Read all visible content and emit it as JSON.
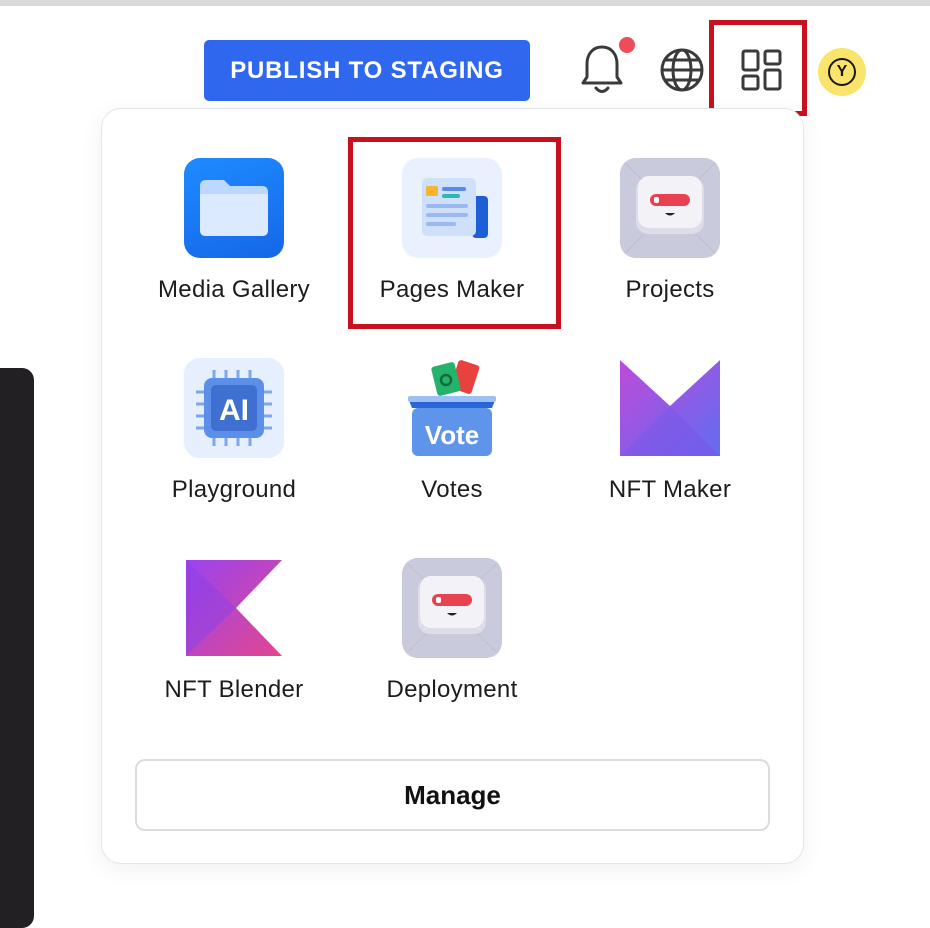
{
  "header": {
    "publish_label": "PUBLISH TO STAGING",
    "notification_icon": "bell-icon",
    "language_icon": "globe-icon",
    "apps_icon": "apps-grid-icon",
    "avatar_initial": "Y",
    "accent_color": "#2f67ee",
    "highlight_color": "#c8101e"
  },
  "apps_menu": {
    "apps": [
      {
        "label": "Media Gallery",
        "icon": "folder-icon"
      },
      {
        "label": "Pages Maker",
        "icon": "pages-maker-icon"
      },
      {
        "label": "Projects",
        "icon": "robot-icon"
      },
      {
        "label": "Playground",
        "icon": "ai-chip-icon"
      },
      {
        "label": "Votes",
        "icon": "vote-box-icon"
      },
      {
        "label": "NFT Maker",
        "icon": "nft-maker-logo-icon"
      },
      {
        "label": "NFT Blender",
        "icon": "nft-blender-logo-icon"
      },
      {
        "label": "Deployment",
        "icon": "robot-icon"
      }
    ],
    "vote_icon_text": "Vote",
    "ai_icon_text": "AI",
    "manage_label": "Manage"
  }
}
